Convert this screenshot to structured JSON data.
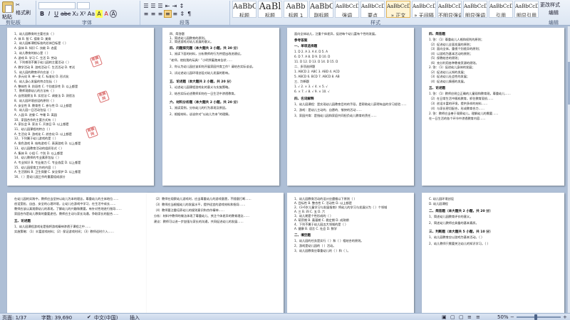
{
  "ribbon": {
    "row1": [
      "粘贴",
      "格式刷"
    ],
    "font_buttons": [
      "B",
      "I",
      "U",
      "abc",
      "X₂",
      "X²",
      "Aa",
      "A",
      "A",
      "A"
    ],
    "para_buttons": [
      "≡",
      "≡",
      "≡",
      "≡",
      "≡",
      "⇕",
      "¶"
    ],
    "styles": [
      {
        "sample": "AaBbC",
        "name": "标题"
      },
      {
        "sample": "AaBl",
        "name": "标题"
      },
      {
        "sample": "AaBb",
        "name": "标题 1"
      },
      {
        "sample": "AaBbC",
        "name": "副标题"
      },
      {
        "sample": "AaBbCcD",
        "name": "强调"
      },
      {
        "sample": "AaBbCcD",
        "name": "要点"
      },
      {
        "sample": "AaBbCcD",
        "name": "» 正文"
      },
      {
        "sample": "AaBbCcD",
        "name": "» 无间隔"
      },
      {
        "sample": "AaBbCcD",
        "name": "不明显强调"
      },
      {
        "sample": "AaBbCcD",
        "name": "明显强调"
      },
      {
        "sample": "AaBbCcD",
        "name": "引用"
      },
      {
        "sample": "AaBbCcD",
        "name": "明显引用"
      }
    ],
    "change_styles": "更改样式",
    "edit": "编辑",
    "group_labels": [
      "剪贴板",
      "字体",
      "段落",
      "样式",
      "编辑"
    ]
  },
  "pages": {
    "p1": {
      "lines": [
        "1、幼儿园教育的主要任务（ ）",
        "A. 体    B. 智    C. 德育    D. 美育",
        "2、幼儿园新课程标准的总体目标是（ ）",
        "A. 身体   B. 知识   C. 技能   D. 态度",
        "3、幼儿教育的核心是（ ）",
        "A. 游戏   B. 学习   C. 生活   D. 劳动",
        "4、下列哪项不属于幼儿园的主要活动（ ）",
        "A. 教学活动   B. 游戏活动   C. 生活活动   D. 考试",
        "5、幼儿园的教育评价应该（ ）",
        "A. 多元化    B. 单一化    C. 标准化    D. 形式化",
        "6、幼儿身心发展的特点包括（ ）",
        "A. 整体性  B. 阶段性  C. 个别差异性  D. 以上都是",
        "7、教师观察幼儿的方法有（ ）",
        "A. 自然观察法  B. 实验法  C. 调查法  D. 测验法",
        "8、幼儿园环境创设的原则（ ）",
        "A. 安全性  B. 教育性  C. 参与性  D. 以上都是",
        "9、幼儿园一日活动包括（ ）",
        "A. 入园  B. 进餐  C. 午睡  D. 离园",
        "10、家园合作的主要方式有（ ）",
        "A. 家长会  B. 家访  C. 开放日  D. 以上都是",
        "11、幼儿园课程的特点（ ）",
        "A. 生活化  B. 游戏化  C. 综合化  D. 以上都是",
        "12、下列属于幼儿游戏的是（ ）",
        "A. 角色游戏  B. 结构游戏  C. 表演游戏  D. 以上都是",
        "13、幼儿园教育活动的组织形式（ ）",
        "A. 集体  B. 小组  C. 个别  D. 以上都是",
        "14、幼儿教师的专业素养包括（ ）",
        "A. 专业知识  B. 专业能力  C. 专业态度  D. 以上都是",
        "15、幼儿园保育工作的内容（ ）",
        "A. 生活照料  B. 卫生保健  C. 安全保护  D. 以上都是",
        "16、（ ）是幼儿园工作的重要组成部分"
      ]
    },
    "p2": {
      "top": [
        "四、简答题",
        "1、简述幼儿园教育的原则。",
        "2、简述游戏对幼儿发展的意义。"
      ],
      "sec1": "四、问题探究题（本大题共 3 小题，共 30 分）",
      "body1": [
        "1、阅读下面的材料，分析教师的行为并提出改进建议。",
        "“老师，他抢我的玩具！”小明哭着跑来告状……",
        "2、你认为幼儿园应该如何开展家园共育工作？请结合实际谈谈。",
        "3、试论述幼儿园环境创设对幼儿发展的影响。"
      ],
      "sec2": "五、论述题（本大题共 2 小题，共 20 分）",
      "body2": [
        "1、论述幼儿园课程游戏化的意义与实施策略。",
        "2、结合实际论述教师如何在一日生活中渗透教育。"
      ],
      "sec3": "六、材料分析题（本大题共 2 小题，共 20 分）",
      "body3": [
        "1、阅读案例，分析幼儿的行为表现及原因。",
        "2、根据材料，谈谈你对“以幼儿为本”的理解。"
      ]
    },
    "p3": {
      "top": [
        "面向全体幼儿，注重个体差异，促进每个幼儿富有个性的发展。"
      ],
      "sec1": "参考答案",
      "sub1": "一、单项选择题",
      "body1": [
        "1. D   2. A   3. A   4. D   5. A",
        "6. D   7. A   8. D   9. D   10. D",
        "11. D  12. D  13. D  14. D  15. D",
        "二、多项选择题",
        "1. ABCD  2. ABC  3. ABD  4. ACD",
        "5. ABCD  6. BCD  7. ABCD  8. AB",
        "三、判断题",
        "1. √  2. ×  3. √  4. ×  5. √",
        "6. ×  7. √  8. √  9. ×  10. √"
      ],
      "sub2": "四、名词解释",
      "body2": [
        "1、幼儿园课程：是实现幼儿园教育目的的手段，是帮助幼儿获得有益的学习经验……",
        "2、游戏：是幼儿主动的、自愿的、愉快的活动……",
        "3、家园共育：是指幼儿园和家庭共同担负幼儿教育的责任……"
      ]
    },
    "p4": {
      "sec1": "四、简答题",
      "body1": [
        "1. 答：（1）尊重幼儿人格和权利的原则；",
        "（2）促进幼儿全面发展的原则；",
        "（3）面向全体，重视个别差异的原则；",
        "（4）以游戏为基本活动的原则；",
        "（5）保教结合的原则；",
        "（6）充分利用各种教育资源的原则。",
        "2. 答：（1）促进幼儿身体的发展；",
        "（2）促进幼儿认知的发展；",
        "（3）促进幼儿社会性的发展；",
        "（4）促进幼儿情感的发展。"
      ],
      "sec2": "五、论述题",
      "body2": [
        "1. 答：（1）教师应树立正确的儿童观和教育观，尊重幼儿……",
        "（2）在日常生活中随机教育，抓住教育契机……",
        "（3）创设丰富的环境，提供多样的材料……",
        "（4）与家长密切配合，形成教育合力……",
        "2. 答：教师应当善于观察幼儿，理解幼儿的需要……",
        "在一日生活的各个环节中渗透教育内容……"
      ]
    },
    "p5": {
      "lines": [
        "在幼儿园的实践中，教师应当坚持以幼儿为本的理念，尊重幼儿的主体地位……",
        "创设宽松、自由、安全的心理环境，让幼儿在游戏中学习、在生活中成长……",
        "教师应该认真观察幼儿的表现，了解幼儿的兴趣和需要，有针对性地进行指导……",
        "家园合作是幼儿教育的重要途径，教师应主动与家长沟通，争取家长的配合……"
      ],
      "sec1": "五、论述题",
      "body1": [
        "1、幼儿园课程游戏化是指将游戏精神渗透于课程之中……",
        "实施策略：（1）丰富游戏材料；（2）保证游戏时间；（3）教师适时介入……"
      ]
    },
    "p6": {
      "lines": [
        "（2）教师在观察幼儿游戏时，应当尊重幼儿的游戏意愿，不随意打断……",
        "（3）教师应当根据幼儿的发展水平，提供适宜的游戏材料和指导……",
        "（4）教师要注重培养幼儿的规则意识和合作精神……",
        "分析：材料中教师的做法体现了尊重幼儿、关注个体差异的教育理念……",
        "建议：教师可以进一步加强与家长的沟通，共同促进幼儿的发展……"
      ]
    },
    "p7": {
      "lines": [
        "1、幼儿园教育活动的设计应遵循以下原则（ ）",
        "A. 目标性  B. 整合性  C. 活动性  D. 以上都是",
        "2、《3-6岁儿童学习与发展指南》将幼儿的学习与发展分为（ ）个领域",
        "A. 三   B. 四   C. 五   D. 六",
        "3、幼儿期是个性形成的（ ）",
        "A. 萌芽期  B. 奠基期  C. 稳定期  D. 成熟期",
        "4、下列不属于幼儿园五大领域的是（ ）",
        "A. 健康  B. 语言  C. 社会  D. 数学"
      ],
      "sec1": "二、填空题",
      "body1": [
        "1、幼儿园的任务是实行（ ）和（ ）相结合的原则。",
        "2、游戏是幼儿园的（ ）活动。",
        "3、幼儿园教育应尊重幼儿的（ ）和（ ）。"
      ]
    },
    "p8": {
      "lines": [
        "C. 幼儿园环境创设",
        "D. 幼儿园课程"
      ],
      "sec1": "二、简答题（本大题共 2 小题，共 20 分）",
      "body1": [
        "1、简述幼儿园教育评价的意义。",
        "2、简述幼儿教师应具备的基本素质。"
      ],
      "sec2": "三、判断题（本大题共 5 小题，共 10 分）",
      "body2": [
        "1、幼儿园教育应以游戏为基本活动。（ ）",
        "2、幼儿教师只需要关注幼儿的知识学习。（ ）"
      ]
    }
  },
  "watermark_text": "希赛网",
  "status": {
    "page": "页面: 1/37",
    "words": "字数: 39,690",
    "lang": "中文(中国)",
    "mode": "插入",
    "zoom": "50%"
  }
}
